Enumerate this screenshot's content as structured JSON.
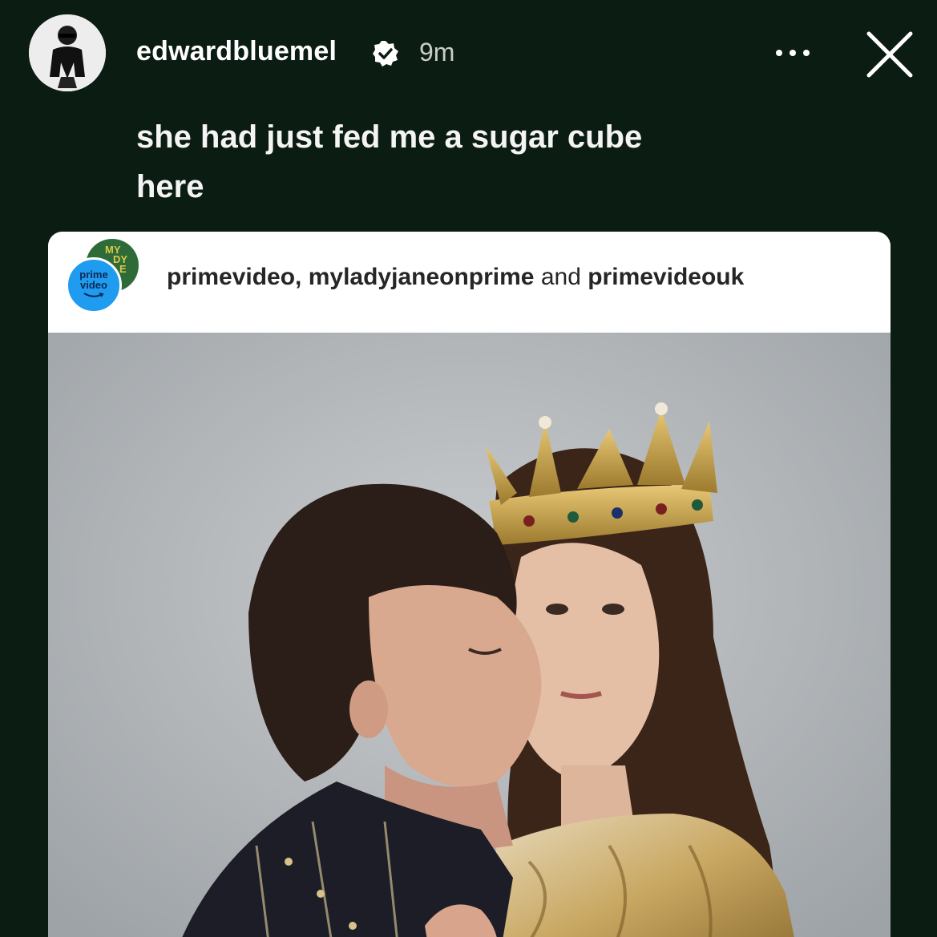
{
  "story": {
    "username": "edwardbluemel",
    "timestamp": "9m",
    "caption": "she had just fed me a sugar cube here"
  },
  "icons": {
    "verified": "verified-badge-icon",
    "more": "more-options-icon",
    "close": "close-icon"
  },
  "shared_post": {
    "account_avatar_back_text": "MY LADY JANE",
    "account_avatar_front_text": "prime video",
    "accounts": {
      "first": "primevideo, myladyjaneonprime",
      "conjunction": "and",
      "last": "primevideouk"
    },
    "image_description": "Promotional photo: curly-haired man in dark doublet kissing the cheek of a woman wearing a golden jeweled crown and gold embroidered gown"
  },
  "colors": {
    "background": "#0b1c12",
    "card": "#ffffff",
    "prime_blue": "#1f9bf0"
  }
}
